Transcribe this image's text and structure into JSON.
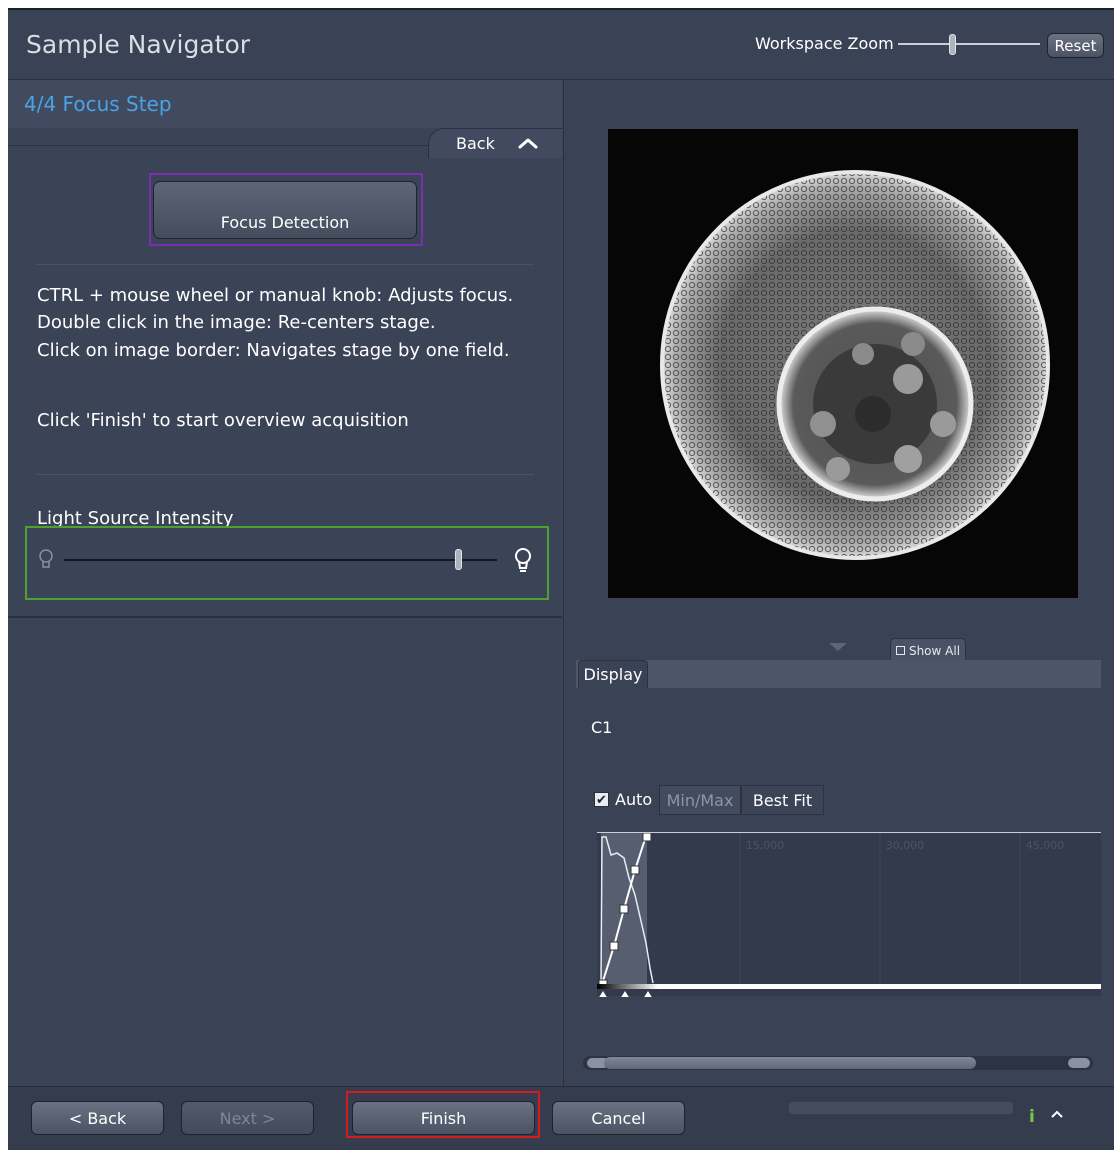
{
  "window": {
    "title": "Sample Navigator"
  },
  "workspace_zoom": {
    "label": "Workspace Zoom",
    "reset_label": "Reset"
  },
  "step": {
    "label": "4/4 Focus Step",
    "back_label": "Back"
  },
  "focus": {
    "button_label": "Focus Detection"
  },
  "instructions": [
    "CTRL + mouse wheel or manual knob: Adjusts focus.",
    "Double click in the image:  Re-centers stage.",
    "Click on image border: Navigates stage by one field.",
    "Click 'Finish' to start overview acquisition"
  ],
  "light": {
    "label": "Light Source Intensity"
  },
  "display": {
    "show_all_label": "Show All",
    "tab_label": "Display",
    "channel": "C1",
    "auto_label": "Auto",
    "auto_checked": true,
    "minmax_label": "Min/Max",
    "bestfit_label": "Best Fit",
    "hist_ticks": [
      "15,000",
      "30,000",
      "45,000"
    ]
  },
  "footer": {
    "back_label": "< Back",
    "next_label": "Next >",
    "finish_label": "Finish",
    "cancel_label": "Cancel",
    "info_icon": "i"
  },
  "colors": {
    "accent_step": "#4aa3e6",
    "focus_highlight": "#7b2fb0",
    "light_highlight": "#4fa030",
    "finish_highlight": "#d51b1b",
    "info_green": "#7ac943"
  }
}
